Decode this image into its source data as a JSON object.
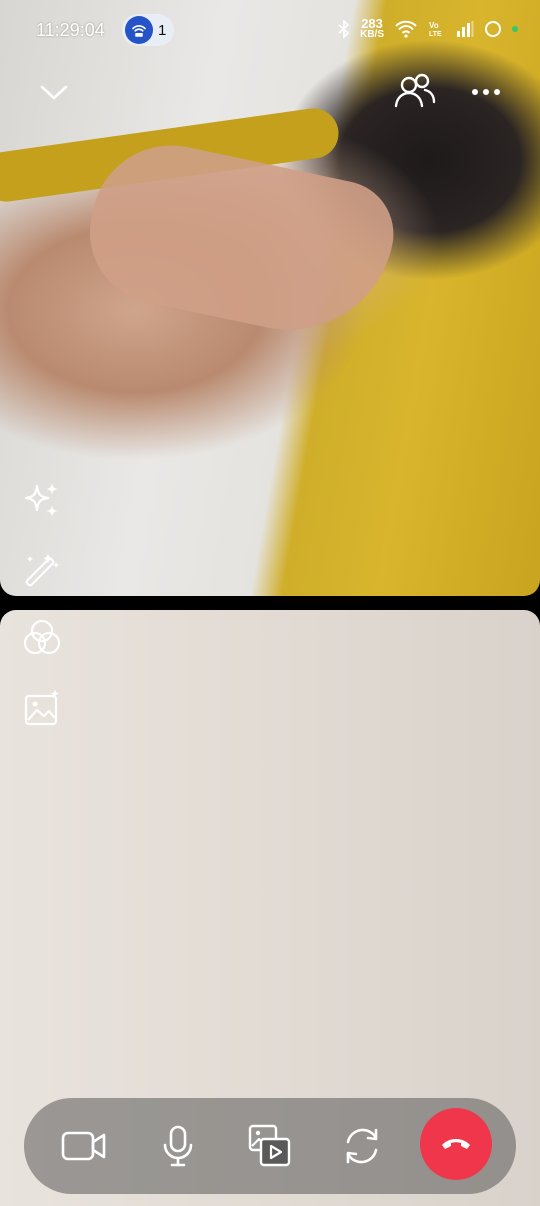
{
  "status_bar": {
    "time": "11:29:04",
    "hotspot_count": "1",
    "net_speed_value": "283",
    "net_speed_unit": "KB/S",
    "icons": [
      "bluetooth-icon",
      "wifi-icon",
      "volte-icon",
      "signal-icon",
      "battery-ring-icon",
      "green-dot"
    ]
  },
  "top_controls": {
    "collapse": "chevron-down-icon",
    "participants": "people-icon",
    "more": "more-icon"
  },
  "side_tools": [
    "sparkles-icon",
    "magic-wand-icon",
    "filters-icon",
    "background-image-icon"
  ],
  "call_bar": {
    "buttons": [
      "video-camera-icon",
      "microphone-icon",
      "share-media-icon",
      "flip-camera-icon",
      "end-call-icon"
    ],
    "end_call_color": "#f0364a"
  },
  "colors": {
    "hotspot_badge": "#e9edf6",
    "hotspot_circle": "#2554c9"
  }
}
